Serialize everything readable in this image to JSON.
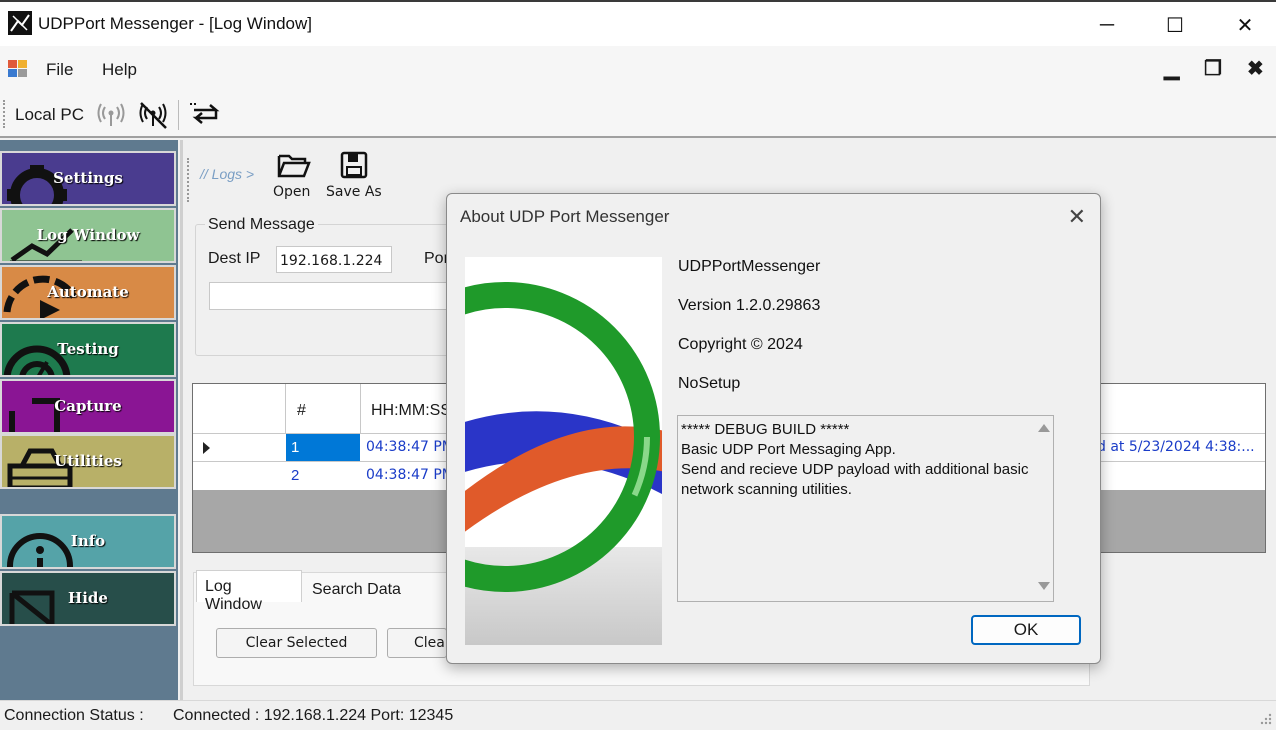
{
  "window": {
    "title": "UDPPort Messenger - [Log Window]",
    "controls": {
      "minimize": "─",
      "maximize": "☐",
      "close": "✕"
    }
  },
  "menu": {
    "items": [
      "File",
      "Help"
    ],
    "mdi_controls": {
      "minimize": "▁",
      "restore": "❐",
      "close": "✖"
    }
  },
  "toolbar": {
    "location_label": "Local PC"
  },
  "sidebar": {
    "items": [
      {
        "label": "Settings",
        "color": "#4a3c8f",
        "icon": "gear-icon"
      },
      {
        "label": "Log Window",
        "color": "#8fc492",
        "icon": "chart-line-icon"
      },
      {
        "label": "Automate",
        "color": "#d88a46",
        "icon": "play-gauge-icon"
      },
      {
        "label": "Testing",
        "color": "#1e7a4e",
        "icon": "gauge-icon"
      },
      {
        "label": "Capture",
        "color": "#8a1594",
        "icon": "capture-icon"
      },
      {
        "label": "Utilities",
        "color": "#b8b068",
        "icon": "toolbox-icon"
      },
      {
        "label": "Info",
        "color": "#55a3a8",
        "icon": "info-icon"
      },
      {
        "label": "Hide",
        "color": "#274e4a",
        "icon": "hide-icon"
      }
    ]
  },
  "log_window": {
    "breadcrumb": "// Logs >",
    "open_label": "Open",
    "save_as_label": "Save As",
    "send_group_label": "Send Message",
    "dest_ip_label": "Dest IP",
    "dest_ip_value": "192.168.1.224",
    "port_label_partial": "Por",
    "grid": {
      "columns": [
        "#",
        "HH:MM:SS"
      ],
      "rows": [
        {
          "num": "1",
          "time": "04:38:47 PM",
          "tail": "d at 5/23/2024 4:38:..."
        },
        {
          "num": "2",
          "time": "04:38:47 PM",
          "tail": ""
        }
      ]
    },
    "tabs": [
      "Log Window",
      "Search Data"
    ],
    "clear_selected_label": "Clear Selected",
    "clear_partial_label": "Clea"
  },
  "about_dialog": {
    "title": "About UDP Port Messenger",
    "product": "UDPPortMessenger",
    "version": "Version 1.2.0.29863",
    "copyright": "Copyright ©  2024",
    "company": "NoSetup",
    "description": "***** DEBUG BUILD *****\nBasic UDP Port Messaging App.\nSend and recieve UDP payload with additional basic network scanning utilities.",
    "ok_label": "OK"
  },
  "status": {
    "label": "Connection Status :",
    "value": "Connected : 192.168.1.224 Port: 12345"
  }
}
